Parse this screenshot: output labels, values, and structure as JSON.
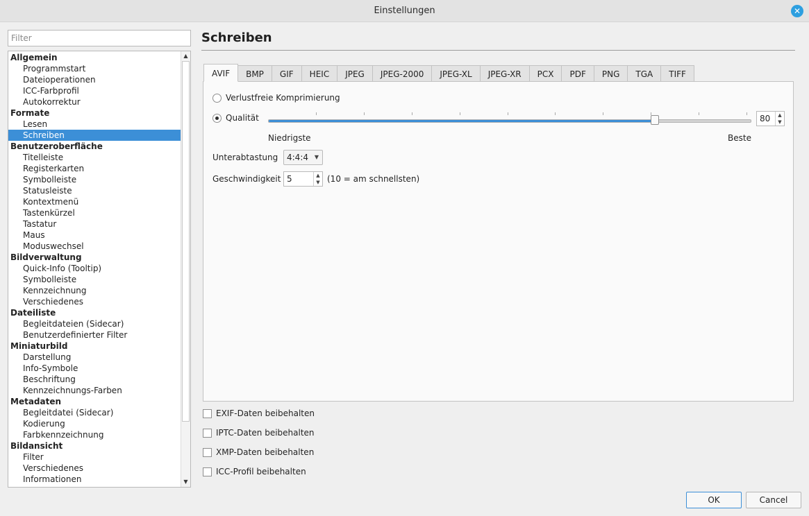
{
  "window": {
    "title": "Einstellungen"
  },
  "sidebar": {
    "filter_placeholder": "Filter",
    "items": [
      {
        "label": "Allgemein",
        "group": true
      },
      {
        "label": "Programmstart",
        "group": false
      },
      {
        "label": "Dateioperationen",
        "group": false
      },
      {
        "label": "ICC-Farbprofil",
        "group": false
      },
      {
        "label": "Autokorrektur",
        "group": false
      },
      {
        "label": "Formate",
        "group": true
      },
      {
        "label": "Lesen",
        "group": false
      },
      {
        "label": "Schreiben",
        "group": false,
        "selected": true
      },
      {
        "label": "Benutzeroberfläche",
        "group": true
      },
      {
        "label": "Titelleiste",
        "group": false
      },
      {
        "label": "Registerkarten",
        "group": false
      },
      {
        "label": "Symbolleiste",
        "group": false
      },
      {
        "label": "Statusleiste",
        "group": false
      },
      {
        "label": "Kontextmenü",
        "group": false
      },
      {
        "label": "Tastenkürzel",
        "group": false
      },
      {
        "label": "Tastatur",
        "group": false
      },
      {
        "label": "Maus",
        "group": false
      },
      {
        "label": "Moduswechsel",
        "group": false
      },
      {
        "label": "Bildverwaltung",
        "group": true
      },
      {
        "label": "Quick-Info (Tooltip)",
        "group": false
      },
      {
        "label": "Symbolleiste",
        "group": false
      },
      {
        "label": "Kennzeichnung",
        "group": false
      },
      {
        "label": "Verschiedenes",
        "group": false
      },
      {
        "label": "Dateiliste",
        "group": true
      },
      {
        "label": "Begleitdateien (Sidecar)",
        "group": false
      },
      {
        "label": "Benutzerdefinierter Filter",
        "group": false
      },
      {
        "label": "Miniaturbild",
        "group": true
      },
      {
        "label": "Darstellung",
        "group": false
      },
      {
        "label": "Info-Symbole",
        "group": false
      },
      {
        "label": "Beschriftung",
        "group": false
      },
      {
        "label": "Kennzeichnungs-Farben",
        "group": false
      },
      {
        "label": "Metadaten",
        "group": true
      },
      {
        "label": "Begleitdatei (Sidecar)",
        "group": false
      },
      {
        "label": "Kodierung",
        "group": false
      },
      {
        "label": "Farbkennzeichnung",
        "group": false
      },
      {
        "label": "Bildansicht",
        "group": true
      },
      {
        "label": "Filter",
        "group": false
      },
      {
        "label": "Verschiedenes",
        "group": false
      },
      {
        "label": "Informationen",
        "group": false
      }
    ]
  },
  "main": {
    "title": "Schreiben",
    "tabs": [
      "AVIF",
      "BMP",
      "GIF",
      "HEIC",
      "JPEG",
      "JPEG-2000",
      "JPEG-XL",
      "JPEG-XR",
      "PCX",
      "PDF",
      "PNG",
      "TGA",
      "TIFF"
    ],
    "active_tab": "AVIF",
    "avif": {
      "lossless_label": "Verlustfreie Komprimierung",
      "quality_label": "Qualität",
      "quality_value": "80",
      "quality_fraction": 0.8,
      "low_label": "Niedrigste",
      "high_label": "Beste",
      "subsampling_label": "Unterabtastung",
      "subsampling_value": "4:4:4",
      "speed_label": "Geschwindigkeit",
      "speed_value": "5",
      "speed_hint": "(10 = am schnellsten)"
    },
    "checkboxes": [
      "EXIF-Daten beibehalten",
      "IPTC-Daten beibehalten",
      "XMP-Daten beibehalten",
      "ICC-Profil beibehalten"
    ]
  },
  "buttons": {
    "ok": "OK",
    "cancel": "Cancel"
  },
  "colors": {
    "accent": "#3c8fd7",
    "close": "#2d9fe0"
  }
}
